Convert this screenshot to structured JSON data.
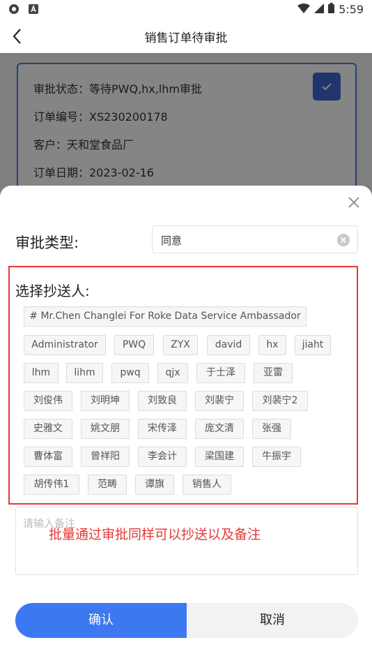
{
  "status_bar": {
    "time": "5:59",
    "icons": [
      "app-icon",
      "a-icon",
      "wifi-icon",
      "signal-icon",
      "battery-icon"
    ]
  },
  "nav": {
    "title": "销售订单待审批",
    "back_icon": "chevron-left-icon"
  },
  "order": {
    "status": "审批状态：等待PWQ,hx,lhm审批",
    "number": "订单编号：XS230200178",
    "customer": "客户：天和堂食品厂",
    "date": "订单日期：2023-02-16",
    "checked": true
  },
  "sheet": {
    "close_icon": "close-icon",
    "approval_type_label": "审批类型:",
    "approval_type_value": "同意",
    "cc_label": "选择抄送人:",
    "cc_people": [
      "# Mr.Chen Changlei For Roke Data Service Ambassador",
      "Administrator",
      "PWQ",
      "ZYX",
      "david",
      "hx",
      "jiaht",
      "lhm",
      "lihm",
      "pwq",
      "qjx",
      "于士泽",
      "亚雷",
      "刘俊伟",
      "刘明坤",
      "刘致良",
      "刘裴宁",
      "刘裴宁2",
      "史雅文",
      "姚文朋",
      "宋传泽",
      "庞文清",
      "张强",
      "曹体富",
      "曾祥阳",
      "李会计",
      "梁国建",
      "牛振宇",
      "胡传伟1",
      "范畴",
      "谭旗",
      "销售人"
    ],
    "remark_placeholder": "请输入备注",
    "annotation": "批量通过审批同样可以抄送以及备注",
    "confirm_label": "确认",
    "cancel_label": "取消"
  },
  "colors": {
    "primary": "#3c78f0",
    "highlight": "#e53935",
    "card_border": "#4b7bd8"
  }
}
